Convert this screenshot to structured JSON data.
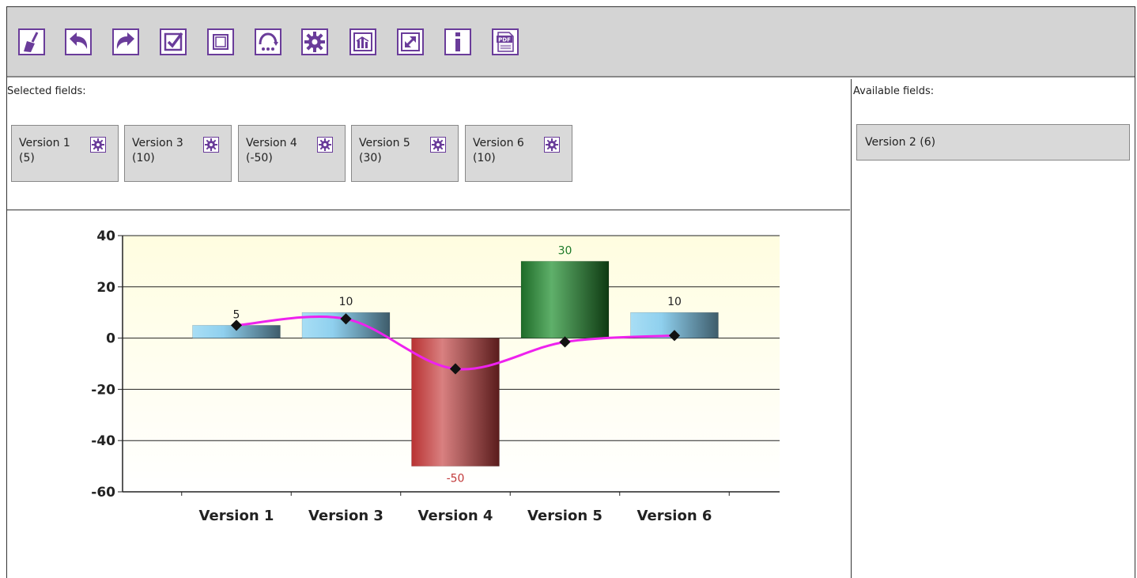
{
  "toolbar": {
    "buttons": [
      {
        "icon": "broom-icon"
      },
      {
        "icon": "undo-icon"
      },
      {
        "icon": "redo-icon"
      },
      {
        "icon": "check-all-icon"
      },
      {
        "icon": "uncheck-all-icon"
      },
      {
        "icon": "refresh-icon"
      },
      {
        "icon": "settings-icon"
      },
      {
        "icon": "chart-icon"
      },
      {
        "icon": "expand-icon"
      },
      {
        "icon": "info-icon"
      },
      {
        "icon": "pdf-icon"
      }
    ],
    "accent_color": "#6a3c9a"
  },
  "selected_fields": {
    "label": "Selected fields:",
    "chips": [
      {
        "name": "Version 1",
        "value": "(5)"
      },
      {
        "name": "Version 3",
        "value": "(10)"
      },
      {
        "name": "Version 4",
        "value": "(-50)"
      },
      {
        "name": "Version 5",
        "value": "(30)"
      },
      {
        "name": "Version 6",
        "value": "(10)"
      }
    ]
  },
  "available_fields": {
    "label": "Available fields:",
    "chips": [
      {
        "name": "Version 2 (6)"
      }
    ]
  },
  "chart_data": {
    "type": "bar",
    "categories": [
      "Version 1",
      "Version 3",
      "Version 4",
      "Version 5",
      "Version 6"
    ],
    "values": [
      5,
      10,
      -50,
      30,
      10
    ],
    "data_labels": [
      "5",
      "10",
      "-50",
      "30",
      "10"
    ],
    "line_series": [
      5,
      7.5,
      -12,
      -1.5,
      1
    ],
    "ylim": [
      -60,
      40
    ],
    "yticks": [
      40,
      20,
      0,
      -20,
      -40,
      -60
    ],
    "grid": true,
    "colors": {
      "default": "#8fd0ee",
      "negative": "#c23a3a",
      "max": "#1e7a2a",
      "line": "#ee22ee",
      "label_default": "#222222",
      "label_negative": "#c23a3a",
      "label_max": "#1e7a2a",
      "plot_background_top": "#fffde0",
      "plot_background_bottom": "#ffffff"
    }
  }
}
